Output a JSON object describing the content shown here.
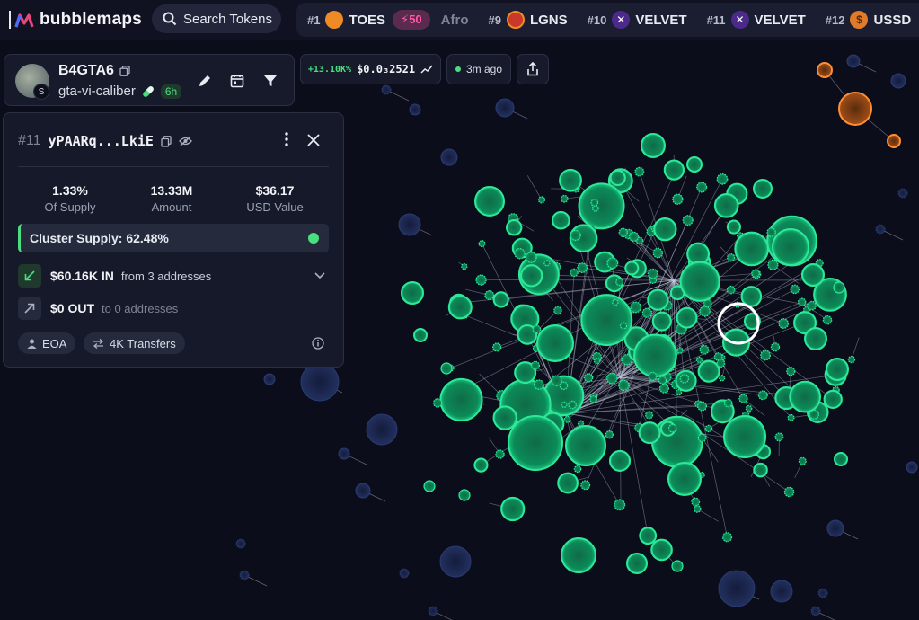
{
  "app": {
    "logo_text": "bubblemaps",
    "search_label": "Search Tokens"
  },
  "ticker": [
    {
      "rank": "#1",
      "name": "TOES",
      "coin_color": "#f08a24",
      "badge": "50"
    },
    {
      "rank": "",
      "name": "Afro",
      "faded": true
    },
    {
      "rank": "#9",
      "name": "LGNS",
      "coin_color": "#c9392b"
    },
    {
      "rank": "#10",
      "name": "VELVET",
      "coin_color": "#4b2a8c"
    },
    {
      "rank": "#11",
      "name": "VELVET",
      "coin_color": "#4b2a8c"
    },
    {
      "rank": "#12",
      "name": "USSD",
      "coin_color": "#e07b2a"
    }
  ],
  "token": {
    "name": "B4GTA6",
    "slug": "gta-vi-caliber",
    "age": "6h",
    "chain_glyph": "S"
  },
  "price": {
    "change": "+13.10K%",
    "value": "$0.0₃2521",
    "updated": "3m ago"
  },
  "wallet": {
    "rank": "#11",
    "address": "yPAARq...LkiE",
    "stats": [
      {
        "value": "1.33%",
        "label": "Of Supply"
      },
      {
        "value": "13.33M",
        "label": "Amount"
      },
      {
        "value": "$36.17",
        "label": "USD Value"
      }
    ],
    "cluster_supply": "Cluster Supply: 62.48%",
    "in_amount": "$60.16K IN",
    "in_from": "from 3 addresses",
    "out_amount": "$0 OUT",
    "out_to": "to 0 addresses",
    "chips": [
      "EOA",
      "4K Transfers"
    ]
  },
  "colors": {
    "accent": "#4ade80",
    "bubble_green": "#1fd38a",
    "bubble_orange": "#f0832a",
    "bubble_dim": "#1d2a55",
    "hot": "#ff5aa8"
  }
}
